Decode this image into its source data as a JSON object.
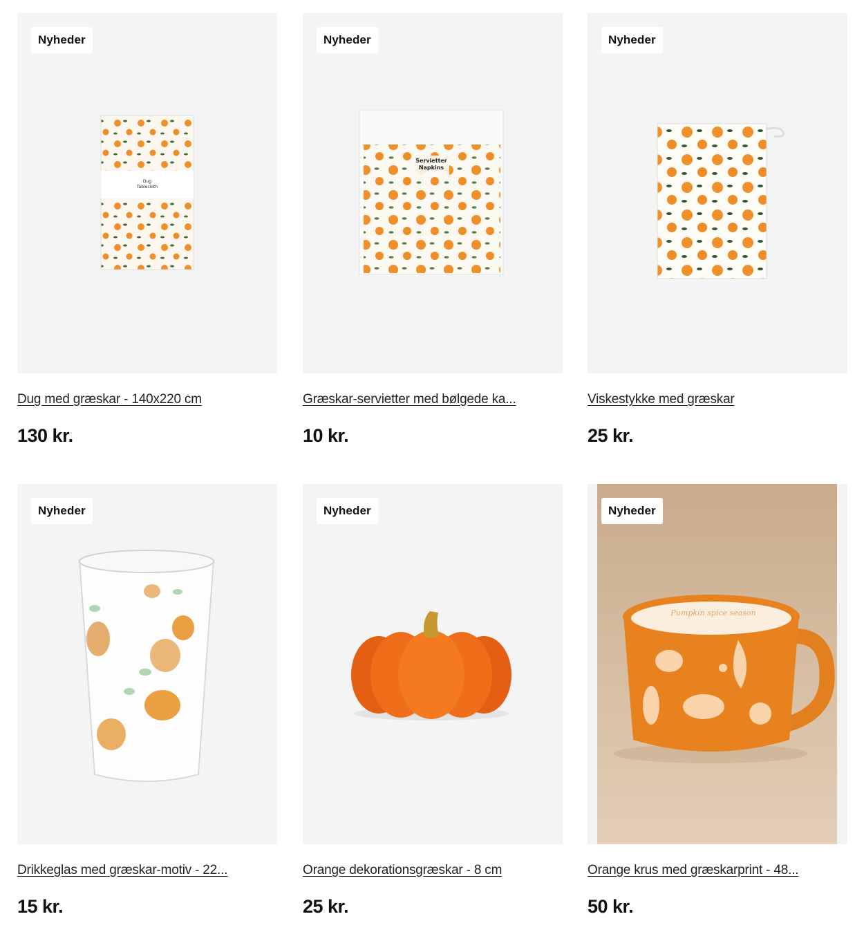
{
  "products": [
    {
      "badge": "Nyheder",
      "title": "Dug med græskar - 140x220 cm",
      "price": "130 kr."
    },
    {
      "badge": "Nyheder",
      "title": "Græskar-servietter med bølgede ka...",
      "price": "10 kr."
    },
    {
      "badge": "Nyheder",
      "title": "Viskestykke med græskar",
      "price": "25 kr."
    },
    {
      "badge": "Nyheder",
      "title": "Drikkeglas med græskar-motiv - 22...",
      "price": "15 kr."
    },
    {
      "badge": "Nyheder",
      "title": "Orange dekorationsgræskar - 8 cm",
      "price": "25 kr."
    },
    {
      "badge": "Nyheder",
      "title": "Orange krus med græskarprint - 48...",
      "price": "50 kr."
    }
  ],
  "package_text": {
    "tablecloth": [
      "Dug",
      "Tablecloth"
    ],
    "napkins": [
      "Servietter",
      "Napkins"
    ],
    "mug": "Pumpkin spice season"
  },
  "colors": {
    "pumpkin": "#f0902a",
    "leaf": "#3f6b3a",
    "card_bg": "#f4f4f4",
    "mug_bg": "#d9c1a6"
  }
}
